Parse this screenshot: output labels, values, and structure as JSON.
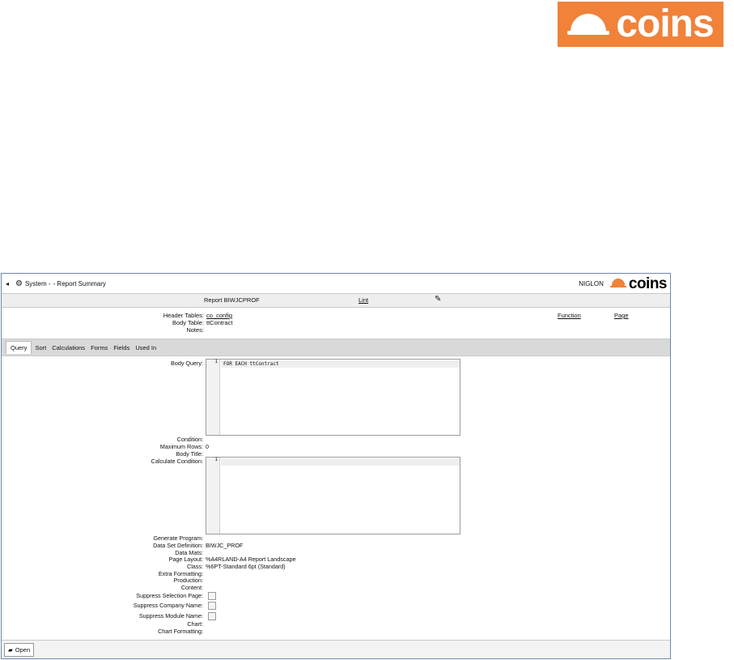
{
  "brand": {
    "logo_text": "coins",
    "accent": "#f0823a"
  },
  "window": {
    "breadcrumb_system": "System -",
    "breadcrumb_page": "- Report Summary",
    "user": "NIGLON",
    "logo_text": "coins"
  },
  "toolbar": {
    "report_label": "Report BIWJCPROF",
    "lint_label": "Lint"
  },
  "header": {
    "header_tables_label": "Header Tables:",
    "header_tables_value": "co_config",
    "body_table_label": "Body Table:",
    "body_table_value": "ttContract",
    "notes_label": "Notes:",
    "function_link": "Function",
    "page_link": "Page"
  },
  "tabs": [
    "Query",
    "Sort",
    "Calculations",
    "Forms",
    "Fields",
    "Used In"
  ],
  "form": {
    "body_query_label": "Body Query:",
    "body_query_line_no": "1",
    "body_query_text": "FOR EACH ttContract",
    "condition_label": "Condition:",
    "max_rows_label": "Maximum Rows:",
    "max_rows_value": "0",
    "body_title_label": "Body Title:",
    "calc_condition_label": "Calculate Condition:",
    "calc_line_no": "1",
    "generate_program_label": "Generate Program:",
    "data_set_label": "Data Set Definition:",
    "data_set_value": "BIWJC_PROF",
    "data_mats_label": "Data Mats:",
    "page_layout_label": "Page Layout:",
    "page_layout_value": "%A4RLAND-A4 Report Landscape",
    "class_label": "Class:",
    "class_value": "%6PT-Standard 6pt (Standard)",
    "extra_formatting_label": "Extra Formatting:",
    "production_label": "Production:",
    "content_label": "Content:",
    "suppress_selection_label": "Suppress Selection Page:",
    "suppress_company_label": "Suppress Company Name:",
    "suppress_module_label": "Suppress Module Name:",
    "chart_label": "Chart:",
    "chart_formatting_label": "Chart Formatting:"
  },
  "footer": {
    "open_label": "Open"
  }
}
